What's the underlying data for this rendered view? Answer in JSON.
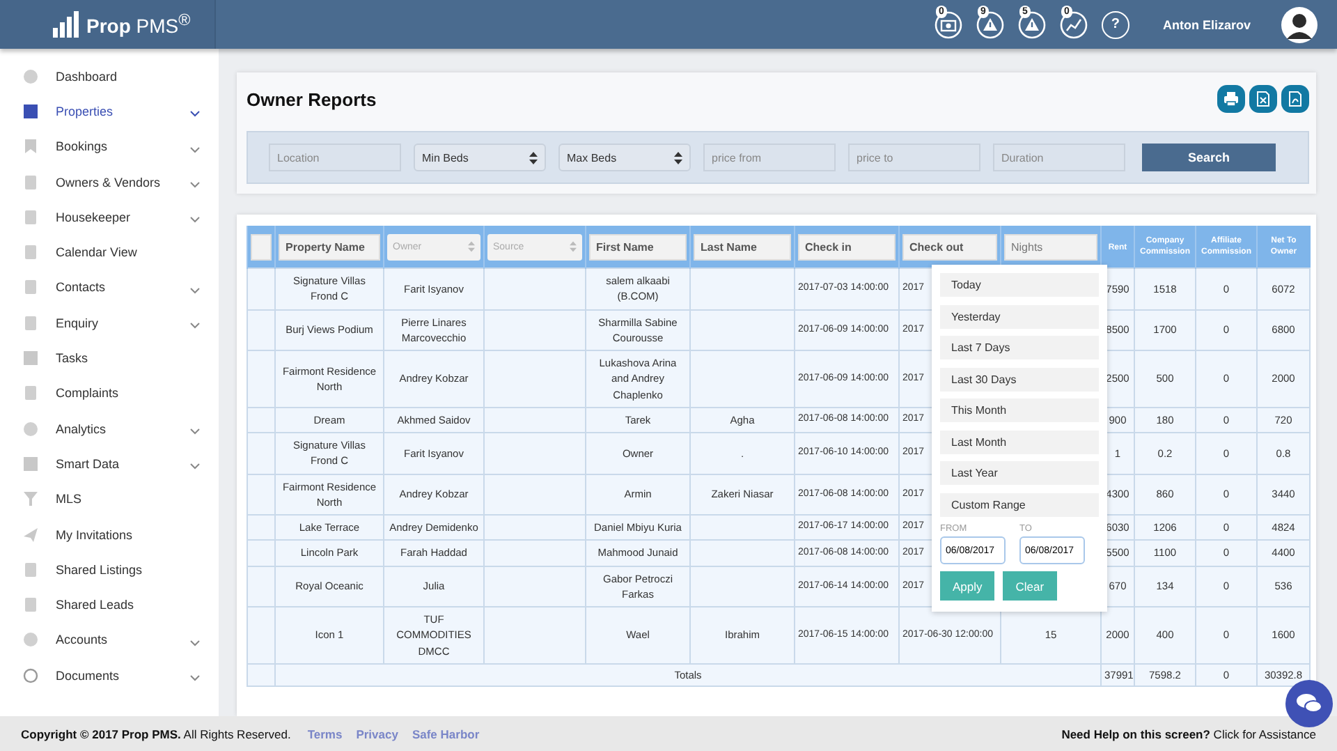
{
  "header": {
    "logo": "**Prop** PMS$^{®}$",
    "notifications": [
      {
        "badge": "0"
      },
      {
        "badge": "9"
      },
      {
        "badge": "5"
      },
      {
        "badge": "0"
      }
    ],
    "help": "?",
    "user_name": "Anton Elizarov"
  },
  "sidebar": {
    "items": [
      {
        "label": "Dashboard",
        "selected": false,
        "expandable": false
      },
      {
        "label": "Properties",
        "selected": true,
        "expandable": true
      },
      {
        "label": "Bookings",
        "selected": false,
        "expandable": true
      },
      {
        "label": "Owners & Vendors",
        "selected": false,
        "expandable": true
      },
      {
        "label": "Housekeeper",
        "selected": false,
        "expandable": true
      },
      {
        "label": "Calendar View",
        "selected": false,
        "expandable": false
      },
      {
        "label": "Contacts",
        "selected": false,
        "expandable": true
      },
      {
        "label": "Enquiry",
        "selected": false,
        "expandable": true
      },
      {
        "label": "Tasks",
        "selected": false,
        "expandable": false
      },
      {
        "label": "Complaints",
        "selected": false,
        "expandable": false
      },
      {
        "label": "Analytics",
        "selected": false,
        "expandable": true
      },
      {
        "label": "Smart Data",
        "selected": false,
        "expandable": true
      },
      {
        "label": "MLS",
        "selected": false,
        "expandable": false
      },
      {
        "label": "My Invitations",
        "selected": false,
        "expandable": false
      },
      {
        "label": "Shared Listings",
        "selected": false,
        "expandable": false
      },
      {
        "label": "Shared Leads",
        "selected": false,
        "expandable": false
      },
      {
        "label": "Accounts",
        "selected": false,
        "expandable": true
      },
      {
        "label": "Documents",
        "selected": false,
        "expandable": true
      }
    ]
  },
  "page": {
    "title": "Owner Reports",
    "filters": [
      {
        "kind": "input",
        "placeholder": "Location"
      },
      {
        "kind": "select",
        "value": "Min Beds"
      },
      {
        "kind": "select",
        "value": "Max Beds"
      },
      {
        "kind": "input",
        "placeholder": "price from"
      },
      {
        "kind": "input",
        "placeholder": "price to"
      },
      {
        "kind": "input",
        "placeholder": "Duration"
      }
    ],
    "search_button": "Search"
  },
  "table": {
    "columns": [
      {
        "kind": "blank"
      },
      {
        "kind": "input",
        "value": "Property Name"
      },
      {
        "kind": "select",
        "placeholder": "Owner"
      },
      {
        "kind": "select",
        "placeholder": "Source"
      },
      {
        "kind": "input",
        "value": "First Name"
      },
      {
        "kind": "input",
        "value": "Last Name"
      },
      {
        "kind": "input",
        "value": "Check in"
      },
      {
        "kind": "input",
        "value": "Check out"
      },
      {
        "kind": "input",
        "placeholder": "Nights"
      },
      {
        "kind": "label",
        "label": "Rent"
      },
      {
        "kind": "label",
        "label": "Company Commission"
      },
      {
        "kind": "label",
        "label": "Affiliate Commission"
      },
      {
        "kind": "label",
        "label": "Net To Owner"
      }
    ],
    "rows": [
      {
        "property": "Signature Villas Frond C",
        "owner": "Farit Isyanov",
        "first_name": "salem alkaabi (B.COM)",
        "check_in": "2017-07-03 14:00:00",
        "check_out": "2017",
        "rent": "7590",
        "company_commission": "1518",
        "affiliate_commission": "0",
        "net_to_owner": "6072"
      },
      {
        "property": "Burj Views Podium",
        "owner": "Pierre Linares Marcovecchio",
        "first_name": "Sharmilla Sabine Courousse",
        "check_in": "2017-06-09 14:00:00",
        "check_out": "2017",
        "rent": "8500",
        "company_commission": "1700",
        "affiliate_commission": "0",
        "net_to_owner": "6800"
      },
      {
        "property": "Fairmont Residence North",
        "owner": "Andrey Kobzar",
        "first_name": "Lukashova Arina and Andrey Chaplenko",
        "check_in": "2017-06-09 14:00:00",
        "check_out": "2017",
        "rent": "2500",
        "company_commission": "500",
        "affiliate_commission": "0",
        "net_to_owner": "2000"
      },
      {
        "property": "Dream",
        "owner": "Akhmed Saidov",
        "first_name": "Tarek",
        "last_name": "Agha",
        "check_in": "2017-06-08 14:00:00",
        "check_out": "2017",
        "rent": "900",
        "company_commission": "180",
        "affiliate_commission": "0",
        "net_to_owner": "720"
      },
      {
        "property": "Signature Villas Frond C",
        "owner": "Farit Isyanov",
        "first_name": "Owner",
        "last_name": ".",
        "check_in": "2017-06-10 14:00:00",
        "check_out": "2017",
        "rent": "1",
        "company_commission": "0.2",
        "affiliate_commission": "0",
        "net_to_owner": "0.8"
      },
      {
        "property": "Fairmont Residence North",
        "owner": "Andrey Kobzar",
        "first_name": "Armin",
        "last_name": "Zakeri Niasar",
        "check_in": "2017-06-08 14:00:00",
        "check_out": "2017",
        "rent": "4300",
        "company_commission": "860",
        "affiliate_commission": "0",
        "net_to_owner": "3440"
      },
      {
        "property": "Lake Terrace",
        "owner": "Andrey Demidenko",
        "first_name": "Daniel Mbiyu Kuria",
        "check_in": "2017-06-17 14:00:00",
        "check_out": "2017",
        "rent": "6030",
        "company_commission": "1206",
        "affiliate_commission": "0",
        "net_to_owner": "4824"
      },
      {
        "property": "Lincoln Park",
        "owner": "Farah Haddad",
        "first_name": "Mahmood Junaid",
        "check_in": "2017-06-08 14:00:00",
        "check_out": "2017",
        "rent": "5500",
        "company_commission": "1100",
        "affiliate_commission": "0",
        "net_to_owner": "4400"
      },
      {
        "property": "Royal Oceanic",
        "owner": "Julia",
        "first_name": "Gabor Petroczi Farkas",
        "check_in": "2017-06-14 14:00:00",
        "check_out": "2017",
        "rent": "670",
        "company_commission": "134",
        "affiliate_commission": "0",
        "net_to_owner": "536"
      },
      {
        "property": "Icon 1",
        "owner": "TUF COMMODITIES DMCC",
        "first_name": "Wael",
        "last_name": "Ibrahim",
        "check_in": "2017-06-15 14:00:00",
        "check_out": "2017-06-30 12:00:00",
        "nights": "15",
        "rent": "2000",
        "company_commission": "400",
        "affiliate_commission": "0",
        "net_to_owner": "1600"
      }
    ],
    "totals": {
      "label": "Totals",
      "rent": "37991",
      "company_commission": "7598.2",
      "affiliate_commission": "0",
      "net_to_owner": "30392.8"
    }
  },
  "date_picker": {
    "ranges": [
      "Today",
      "Yesterday",
      "Last 7 Days",
      "Last 30 Days",
      "This Month",
      "Last Month",
      "Last Year",
      "Custom Range"
    ],
    "from_label": "FROM",
    "from": "06/08/2017",
    "to_label": "TO",
    "to": "06/08/2017",
    "apply": "Apply",
    "clear": "Clear"
  },
  "footer": {
    "copyright": "**Copyright © 2017 Prop PMS.** All Rights Reserved.",
    "links": [
      "Terms",
      "Privacy",
      "Safe Harbor"
    ],
    "help": "**Need Help on this screen?** Click for Assistance"
  }
}
